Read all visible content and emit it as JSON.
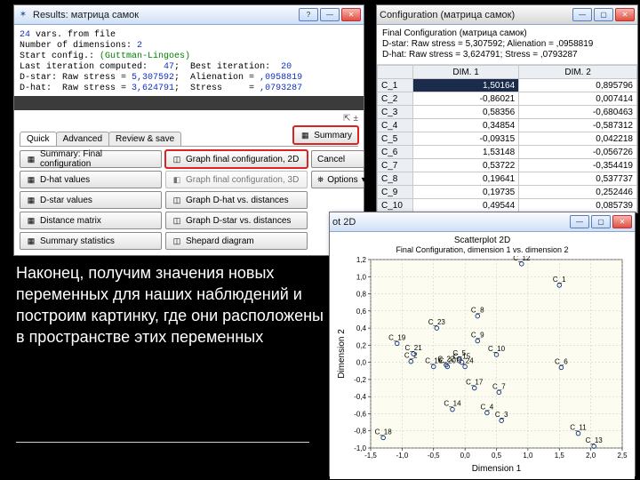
{
  "results_window": {
    "title": "Results: матрица самок",
    "info_html": "<span class='blue'>24</span> vars. from file\nNumber of dimensions: <span class='blue'>2</span>\nStart config.: <span class='green'>(Guttman-Lingoes)</span>\nLast iteration computed: <span class='blue'>  47</span>;  Best iteration:  <span class='blue'>20</span>\nD-star: Raw stress = <span class='blue'>5,307592</span>;  Alienation = <span class='blue'>,0958819</span>\nD-hat:  Raw stress = <span class='blue'>3,624791</span>;  Stress     = <span class='blue'>,0793287</span>",
    "tabs": [
      "Quick",
      "Advanced",
      "Review & save"
    ],
    "summary_label": "Summary",
    "panel": {
      "summary_final": "Summary: Final configuration",
      "graph2d": "Graph final configuration, 2D",
      "cancel": "Cancel",
      "dhat": "D-hat values",
      "graph3d": "Graph final configuration, 3D",
      "options": "Options",
      "dstar": "D-star values",
      "graph_dhat": "Graph D-hat vs. distances",
      "distmat": "Distance matrix",
      "graph_dstar": "Graph D-star vs. distances",
      "sumstat": "Summary statistics",
      "shepard": "Shepard diagram"
    }
  },
  "config_window": {
    "title": "Configuration (матрица самок)",
    "info1": "Final Configuration (матрица самок)",
    "info2": "D-star: Raw stress = 5,307592; Alienation = ,0958819",
    "info3": "D-hat: Raw stress = 3,624791; Stress = ,0793287",
    "headers": [
      "",
      "DIM. 1",
      "DIM. 2"
    ],
    "rows": [
      {
        "name": "C_1",
        "d1": "1,50164",
        "d2": "0,895796"
      },
      {
        "name": "C_2",
        "d1": "-0,86021",
        "d2": "0,007414"
      },
      {
        "name": "C_3",
        "d1": "0,58356",
        "d2": "-0,680463"
      },
      {
        "name": "C_4",
        "d1": "0,34854",
        "d2": "-0,587312"
      },
      {
        "name": "C_5",
        "d1": "-0,09315",
        "d2": "0,042218"
      },
      {
        "name": "C_6",
        "d1": "1,53148",
        "d2": "-0,056726"
      },
      {
        "name": "C_7",
        "d1": "0,53722",
        "d2": "-0,354419"
      },
      {
        "name": "C_8",
        "d1": "0,19641",
        "d2": "0,537737"
      },
      {
        "name": "C_9",
        "d1": "0,19735",
        "d2": "0,252446"
      },
      {
        "name": "C_10",
        "d1": "0,49544",
        "d2": "0,085739"
      }
    ]
  },
  "scatter_window": {
    "title": "ot 2D",
    "plot_title": "Scatterplot 2D",
    "plot_sub": "Final Configuration, dimension 1  vs. dimension 2",
    "xlabel": "Dimension 1",
    "ylabel": "Dimension 2"
  },
  "chart_data": {
    "type": "scatter",
    "xlabel": "Dimension 1",
    "ylabel": "Dimension 2",
    "xticks": [
      -1.5,
      -1.0,
      -0.5,
      0.0,
      0.5,
      1.0,
      1.5,
      2.0,
      2.5
    ],
    "yticks": [
      -1.0,
      -0.8,
      -0.6,
      -0.4,
      -0.2,
      0.0,
      0.2,
      0.4,
      0.6,
      0.8,
      1.0,
      1.2
    ],
    "points": [
      {
        "label": "C_1",
        "x": 1.5,
        "y": 0.9
      },
      {
        "label": "C_2",
        "x": -0.86,
        "y": 0.01
      },
      {
        "label": "C_3",
        "x": 0.58,
        "y": -0.68
      },
      {
        "label": "C_4",
        "x": 0.35,
        "y": -0.59
      },
      {
        "label": "C_5",
        "x": -0.09,
        "y": 0.04
      },
      {
        "label": "C_6",
        "x": 1.53,
        "y": -0.06
      },
      {
        "label": "C_7",
        "x": 0.54,
        "y": -0.35
      },
      {
        "label": "C_8",
        "x": 0.2,
        "y": 0.54
      },
      {
        "label": "C_9",
        "x": 0.2,
        "y": 0.25
      },
      {
        "label": "C_10",
        "x": 0.5,
        "y": 0.09
      },
      {
        "label": "C_11",
        "x": 1.8,
        "y": -0.83
      },
      {
        "label": "C_12",
        "x": 0.9,
        "y": 1.15
      },
      {
        "label": "C_13",
        "x": 2.05,
        "y": -0.98
      },
      {
        "label": "C_14",
        "x": -0.2,
        "y": -0.55
      },
      {
        "label": "C_15",
        "x": -0.05,
        "y": 0.0
      },
      {
        "label": "C_16",
        "x": -0.5,
        "y": -0.05
      },
      {
        "label": "C_17",
        "x": 0.15,
        "y": -0.3
      },
      {
        "label": "C_18",
        "x": -1.3,
        "y": -0.88
      },
      {
        "label": "C_19",
        "x": -1.08,
        "y": 0.22
      },
      {
        "label": "C_20",
        "x": -0.28,
        "y": -0.05
      },
      {
        "label": "C_21",
        "x": -0.82,
        "y": 0.1
      },
      {
        "label": "C_22",
        "x": -0.3,
        "y": -0.03
      },
      {
        "label": "C_23",
        "x": -0.45,
        "y": 0.4
      },
      {
        "label": "C_24",
        "x": 0.0,
        "y": -0.05
      }
    ]
  },
  "caption": "Наконец, получим значения новых переменных для наших наблюдений и построим картинку, где они расположены в пространстве этих переменных"
}
